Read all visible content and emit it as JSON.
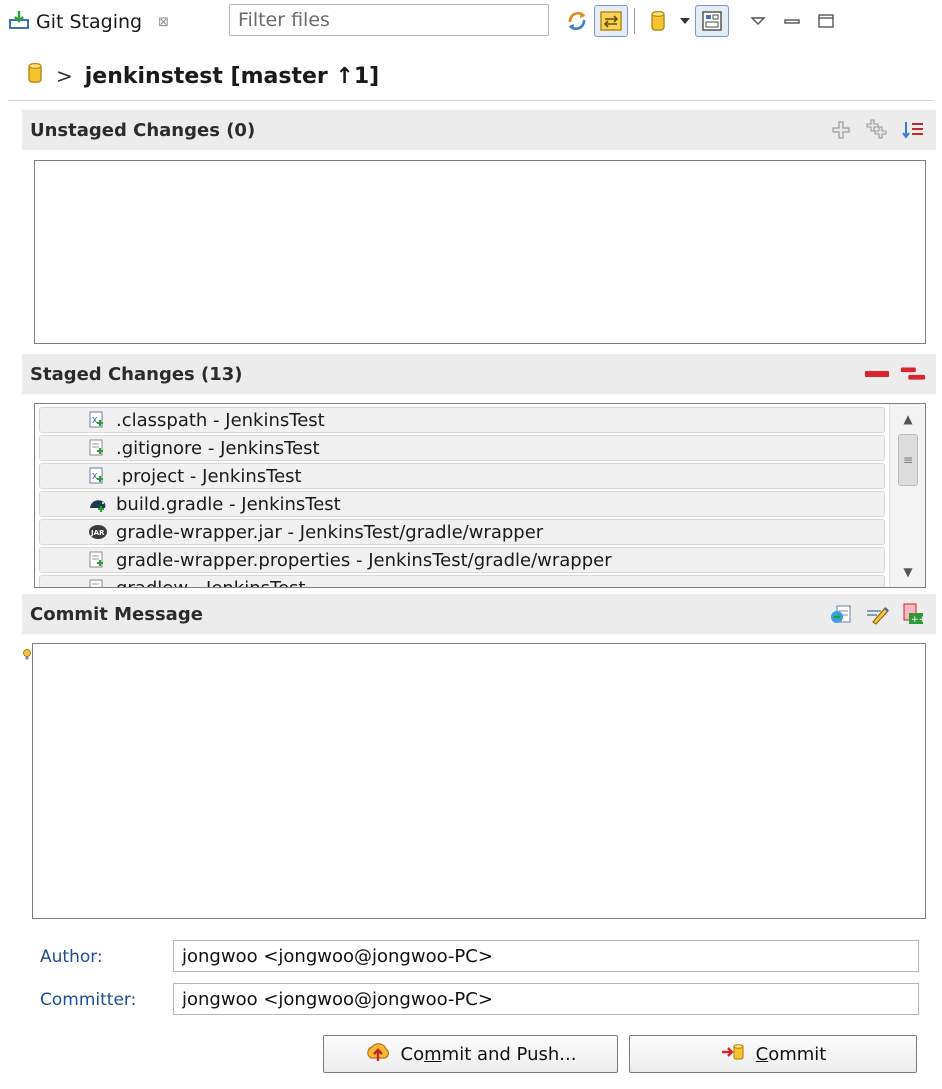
{
  "view_tab": {
    "title": "Git Staging",
    "close_glyph": "⊠",
    "icon": "git-staging-icon"
  },
  "toolbar": {
    "filter_placeholder": "Filter files",
    "icons": [
      "refresh-icon",
      "link-with-selection-icon",
      "repository-icon",
      "dropdown-arrow-icon",
      "presentation-mode-icon",
      "view-menu-icon",
      "minimize-icon",
      "maximize-icon"
    ]
  },
  "repo": {
    "separator": ">",
    "label": "jenkinstest [master ↑1]"
  },
  "unstaged": {
    "title": "Unstaged Changes (0)",
    "items": []
  },
  "staged": {
    "title": "Staged Changes (13)",
    "items": [
      {
        "label": ".classpath - JenkinsTest",
        "icon": "xml-file-added-icon"
      },
      {
        "label": ".gitignore - JenkinsTest",
        "icon": "text-file-added-icon"
      },
      {
        "label": ".project - JenkinsTest",
        "icon": "xml-file-added-icon"
      },
      {
        "label": "build.gradle - JenkinsTest",
        "icon": "gradle-file-added-icon"
      },
      {
        "label": "gradle-wrapper.jar - JenkinsTest/gradle/wrapper",
        "icon": "jar-file-added-icon"
      },
      {
        "label": "gradle-wrapper.properties - JenkinsTest/gradle/wrapper",
        "icon": "text-file-added-icon"
      },
      {
        "label": "gradlew - JenkinsTest",
        "icon": "text-file-added-icon"
      }
    ]
  },
  "commit_message": {
    "title": "Commit Message",
    "value": ""
  },
  "author": {
    "label": "Author:",
    "value": "jongwoo <jongwoo@jongwoo-PC>"
  },
  "committer": {
    "label": "Committer:",
    "value": "jongwoo <jongwoo@jongwoo-PC>"
  },
  "buttons": {
    "commit_and_push_prefix": "Co",
    "commit_and_push_mnemonic": "m",
    "commit_and_push_suffix": "mit and Push...",
    "commit_mnemonic": "C",
    "commit_suffix": "ommit"
  },
  "colors": {
    "section_bar": "#ececec",
    "label_blue": "#1e4f91",
    "unstage_red": "#d9232e",
    "repo_yellow": "#f1c232"
  }
}
